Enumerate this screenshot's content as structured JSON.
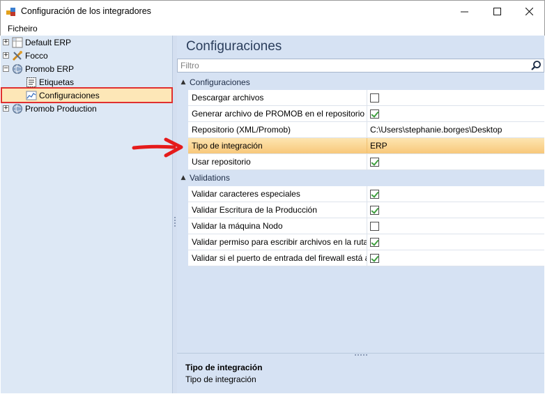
{
  "window": {
    "title": "Configuración de los integradores"
  },
  "menu": {
    "items": [
      "Ficheiro"
    ]
  },
  "tree": {
    "items": [
      {
        "label": "Default ERP",
        "icon": "grid-icon",
        "expander": "+"
      },
      {
        "label": "Focco",
        "icon": "tools-icon",
        "expander": "+"
      },
      {
        "label": "Promob ERP",
        "icon": "globe-icon",
        "expander": "−"
      },
      {
        "label": "Etiquetas",
        "icon": "label-icon"
      },
      {
        "label": "Configuraciones",
        "icon": "chart-icon",
        "selected": true
      },
      {
        "label": "Promob Production",
        "icon": "globe-icon",
        "expander": "+"
      }
    ]
  },
  "panel": {
    "title": "Configuraciones",
    "filter_placeholder": "Filtro"
  },
  "grid": {
    "categories": [
      {
        "label": "Configuraciones",
        "caret": "▲",
        "rows": [
          {
            "name": "Descargar archivos",
            "type": "check",
            "checked": false
          },
          {
            "name": "Generar archivo de PROMOB en el repositorio",
            "type": "check",
            "checked": true
          },
          {
            "name": "Repositorio (XML/Promob)",
            "type": "text",
            "value": "C:\\Users\\stephanie.borges\\Desktop"
          },
          {
            "name": "Tipo de integración",
            "type": "text",
            "value": "ERP",
            "highlight": true
          },
          {
            "name": "Usar repositorio",
            "type": "check",
            "checked": true
          }
        ]
      },
      {
        "label": "Validations",
        "caret": "▲",
        "rows": [
          {
            "name": "Validar caracteres especiales",
            "type": "check",
            "checked": true
          },
          {
            "name": "Validar Escritura de la Producción",
            "type": "check",
            "checked": true
          },
          {
            "name": "Validar la máquina Nodo",
            "type": "check",
            "checked": false
          },
          {
            "name": "Validar permiso para escribir archivos en la ruta...",
            "type": "check",
            "checked": true
          },
          {
            "name": "Validar si el puerto de entrada del firewall está a...",
            "type": "check",
            "checked": true
          }
        ]
      }
    ]
  },
  "description": {
    "title": "Tipo de integración",
    "text": "Tipo de integración"
  },
  "colors": {
    "highlight": "#f8c87a",
    "selection_border": "#e03030",
    "arrow": "#e51b1b"
  }
}
